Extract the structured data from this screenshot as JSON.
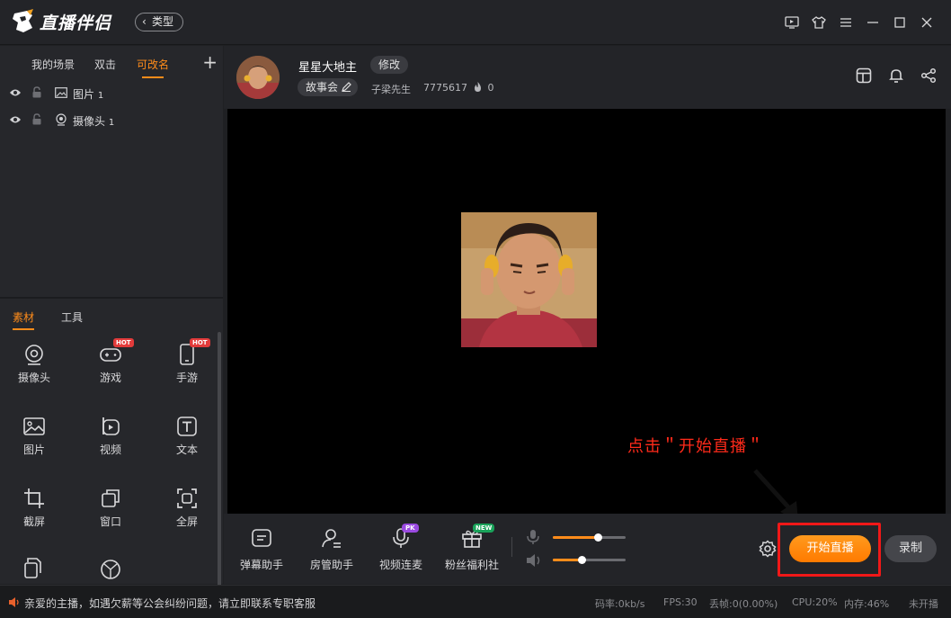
{
  "app": {
    "name": "直播伴侣",
    "type_button": "类型"
  },
  "scenes": {
    "tabs": [
      "我的场景",
      "双击",
      "可改名"
    ],
    "active": 2
  },
  "sources": [
    {
      "name": "图片",
      "index": "1",
      "icon": "image-icon"
    },
    {
      "name": "摄像头",
      "index": "1",
      "icon": "camera-icon"
    }
  ],
  "materials": {
    "tabs": [
      "素材",
      "工具"
    ],
    "items": [
      {
        "label": "摄像头",
        "icon": "camera-icon"
      },
      {
        "label": "游戏",
        "icon": "gamepad-icon",
        "badge": "HOT"
      },
      {
        "label": "手游",
        "icon": "phone-icon",
        "badge": "HOT"
      },
      {
        "label": "图片",
        "icon": "image-icon"
      },
      {
        "label": "视频",
        "icon": "video-icon"
      },
      {
        "label": "文本",
        "icon": "text-icon"
      },
      {
        "label": "截屏",
        "icon": "crop-icon"
      },
      {
        "label": "窗口",
        "icon": "window-icon"
      },
      {
        "label": "全屏",
        "icon": "fullscreen-icon"
      }
    ]
  },
  "header": {
    "streamer_name": "星星大地主",
    "edit_label": "修改",
    "category": "故事会",
    "nickname": "子梁先生",
    "room_id": "7775617",
    "heat": "0"
  },
  "preview": {
    "hint": "点击＂开始直播＂"
  },
  "toolbar": {
    "tools": [
      {
        "label": "弹幕助手",
        "icon": "danmaku-icon"
      },
      {
        "label": "房管助手",
        "icon": "admin-icon"
      },
      {
        "label": "视频连麦",
        "icon": "video-link-icon",
        "badge": "PK"
      },
      {
        "label": "粉丝福利社",
        "icon": "gift-icon",
        "badge": "NEW"
      }
    ],
    "mic_volume": 0.62,
    "speaker_volume": 0.4,
    "start_label": "开始直播",
    "record_label": "录制"
  },
  "status": {
    "notice": "亲爱的主播，如遇欠薪等公会纠纷问题，请立即联系专职客服",
    "bitrate": "码率:0kb/s",
    "fps": "FPS:30",
    "dropped": "丢帧:0(0.00%)",
    "cpu": "CPU:20%",
    "memory": "内存:46%",
    "state": "未开播"
  },
  "colors": {
    "accent": "#ff8c1a",
    "highlight": "#f01818",
    "hint": "#ff2a1a"
  }
}
